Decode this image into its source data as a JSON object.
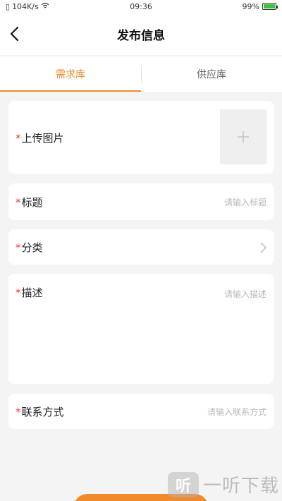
{
  "status_bar": {
    "network_speed": "104K/s",
    "time": "09:36",
    "battery": "99%"
  },
  "nav": {
    "title": "发布信息"
  },
  "tabs": [
    {
      "label": "需求库",
      "active": true
    },
    {
      "label": "供应库",
      "active": false
    }
  ],
  "form": {
    "required_mark": "*",
    "upload": {
      "label": "上传图片"
    },
    "title": {
      "label": "标题",
      "placeholder": "请输入标题"
    },
    "category": {
      "label": "分类"
    },
    "description": {
      "label": "描述",
      "placeholder": "请输入描述"
    },
    "contact": {
      "label": "联系方式",
      "placeholder": "请输入联系方式"
    }
  },
  "watermark": {
    "logo": "听",
    "text": "一听下载"
  },
  "colors": {
    "accent": "#f08a2c",
    "required": "#e03b3b",
    "background": "#f4f4f4"
  }
}
